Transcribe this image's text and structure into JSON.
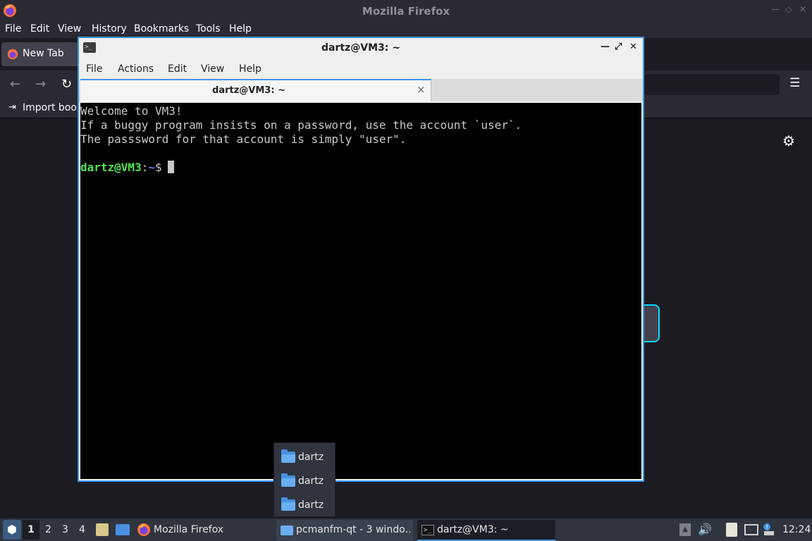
{
  "firefox": {
    "window_title": "Mozilla Firefox",
    "menu": [
      "File",
      "Edit",
      "View",
      "History",
      "Bookmarks",
      "Tools",
      "Help"
    ],
    "tab_label": "New Tab",
    "bookmarks_item": "Import book",
    "icons": {
      "logo": "firefox-logo-icon",
      "back": "back-arrow-icon",
      "forward": "forward-arrow-icon",
      "reload": "reload-icon",
      "menu": "hamburger-menu-icon",
      "settings": "gear-icon"
    }
  },
  "terminal": {
    "window_title": "dartz@VM3: ~",
    "menu": [
      "File",
      "Actions",
      "Edit",
      "View",
      "Help"
    ],
    "tab_label": "dartz@VM3: ~",
    "tab_close": "×",
    "lines": [
      "Welcome to VM3!",
      "If a buggy program insists on a password, use the account `user`.",
      "The passsword for that account is simply \"user\"."
    ],
    "prompt": {
      "user_host": "dartz@VM3",
      "colon": ":",
      "path": "~",
      "sign": "$"
    },
    "colors": {
      "background": "#000000",
      "text": "#c8c8c8",
      "prompt_user": "#54e454",
      "prompt_path": "#5c8cf0",
      "accent": "#3d96e6"
    }
  },
  "popup": {
    "items": [
      "dartz",
      "dartz",
      "dartz"
    ]
  },
  "taskbar": {
    "workspaces": [
      "1",
      "2",
      "3",
      "4"
    ],
    "active_workspace": "1",
    "quicklaunch_firefox_label": "Mozilla Firefox",
    "tasks": [
      "pcmanfm-qt - 3 windo…",
      "dartz@VM3: ~"
    ],
    "clock": "12:24",
    "tray_icons": [
      "tray-up-arrow-icon",
      "volume-icon",
      "clipboard-icon",
      "network-icon",
      "notification-icon"
    ]
  }
}
